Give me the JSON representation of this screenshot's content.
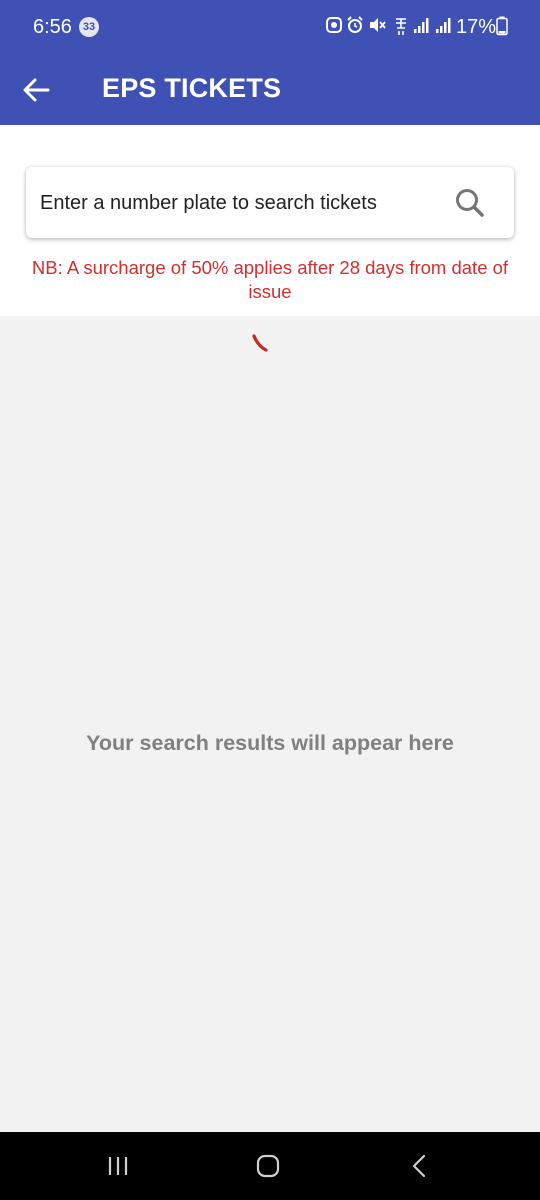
{
  "status_bar": {
    "time": "6:56",
    "notification_count": "33",
    "battery_percent": "17%",
    "icons": [
      "whatsapp-icon",
      "alarm-icon",
      "mute-icon",
      "wifi-calling-icon",
      "signal-icon",
      "signal-icon",
      "battery-icon"
    ]
  },
  "app_bar": {
    "title": "EPS TICKETS",
    "back_icon": "arrow-left-icon"
  },
  "search": {
    "placeholder": "Enter a number plate to search tickets",
    "value": "",
    "icon": "search-icon"
  },
  "notice": "NB: A surcharge of 50% applies after 28 days from date of issue",
  "results": {
    "empty_message": "Your search results will appear here"
  },
  "nav_bar": {
    "recents_icon": "recents-icon",
    "home_icon": "home-icon",
    "back_icon": "back-icon"
  },
  "colors": {
    "primary": "#3f51b5",
    "notice_red": "#d32f2f",
    "background": "#f2f2f2",
    "empty_text": "#808080"
  }
}
